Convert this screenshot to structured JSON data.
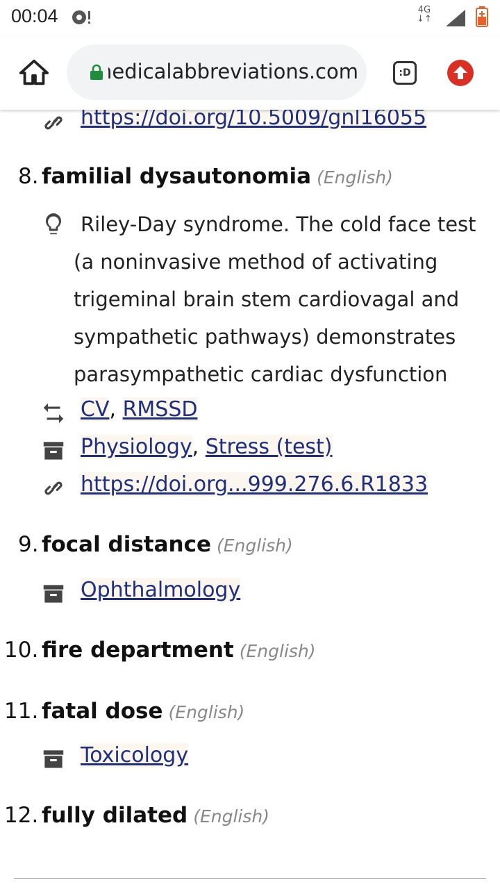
{
  "status_bar": {
    "time": "00:04",
    "network": "4G"
  },
  "browser": {
    "url": "medicalabbreviations.com",
    "tab_switcher_label": ":D"
  },
  "top_link": {
    "url": "https://doi.org/10.5009/gnl16055"
  },
  "entries": [
    {
      "number": "8.",
      "term": "familial dysautonomia",
      "language": "(English)",
      "description": "Riley-Day syndrome. The cold face test (a noninvasive method of activating trigeminal brain stem cardiovagal and sympathetic pathways) demonstrates parasympathetic cardiac dysfunction",
      "synonyms": [
        "CV",
        "RMSSD"
      ],
      "categories": [
        "Physiology",
        "Stress (test)"
      ],
      "doi": "https://doi.org...999.276.6.R1833"
    },
    {
      "number": "9.",
      "term": "focal distance",
      "language": "(English)",
      "categories": [
        "Ophthalmology"
      ]
    },
    {
      "number": "10.",
      "term": "fire department",
      "language": "(English)"
    },
    {
      "number": "11.",
      "term": "fatal dose",
      "language": "(English)",
      "categories": [
        "Toxicology"
      ]
    },
    {
      "number": "12.",
      "term": "fully dilated",
      "language": "(English)"
    }
  ],
  "icons": {
    "link": "link-icon",
    "idea": "lightbulb-icon",
    "synonym": "swap-arrows-icon",
    "category": "archive-box-icon"
  }
}
